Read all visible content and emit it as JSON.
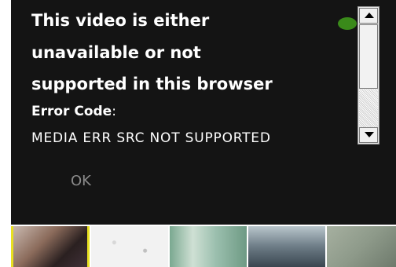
{
  "dialog": {
    "title_line1": "This video is either",
    "title_line2": "unavailable or not",
    "title_line3": "supported in this browser",
    "error_label": "Error Code",
    "error_colon": ":",
    "error_code": "MEDIA ERR SRC NOT SUPPORTED",
    "ok_label": "OK"
  },
  "icons": {
    "scroll_up": "triangle-up-icon",
    "scroll_down": "triangle-down-icon"
  },
  "colors": {
    "player_bg": "#141414",
    "text": "#ffffff",
    "ok_text": "#8a8a8a",
    "selected_thumb_border": "#e8e020"
  }
}
